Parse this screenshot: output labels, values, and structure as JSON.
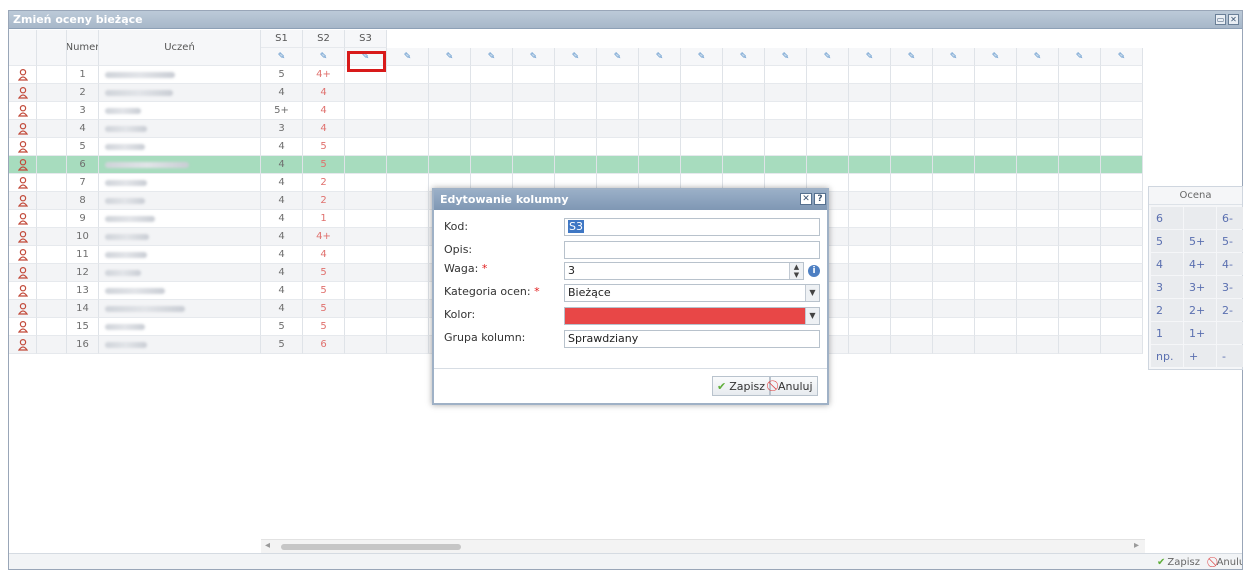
{
  "window": {
    "title": "Zmień oceny bieżące"
  },
  "grid": {
    "headers": {
      "numer": "Numer",
      "uczen": "Uczeń",
      "s1": "S1",
      "s2": "S2",
      "s3": "S3"
    },
    "rows": [
      {
        "num": "1",
        "s1": "5",
        "s2": "4+"
      },
      {
        "num": "2",
        "s1": "4",
        "s2": "4"
      },
      {
        "num": "3",
        "s1": "5+",
        "s2": "4"
      },
      {
        "num": "4",
        "s1": "3",
        "s2": "4"
      },
      {
        "num": "5",
        "s1": "4",
        "s2": "5"
      },
      {
        "num": "6",
        "s1": "4",
        "s2": "5"
      },
      {
        "num": "7",
        "s1": "4",
        "s2": "2"
      },
      {
        "num": "8",
        "s1": "4",
        "s2": "2"
      },
      {
        "num": "9",
        "s1": "4",
        "s2": "1"
      },
      {
        "num": "10",
        "s1": "4",
        "s2": "4+"
      },
      {
        "num": "11",
        "s1": "4",
        "s2": "4"
      },
      {
        "num": "12",
        "s1": "4",
        "s2": "5"
      },
      {
        "num": "13",
        "s1": "4",
        "s2": "5"
      },
      {
        "num": "14",
        "s1": "4",
        "s2": "5"
      },
      {
        "num": "15",
        "s1": "5",
        "s2": "5"
      },
      {
        "num": "16",
        "s1": "5",
        "s2": "6"
      }
    ]
  },
  "ocena_panel": {
    "header": "Ocena",
    "grades": [
      "6",
      "",
      "6-",
      "5",
      "5+",
      "5-",
      "4",
      "4+",
      "4-",
      "3",
      "3+",
      "3-",
      "2",
      "2+",
      "2-",
      "1",
      "1+",
      "",
      "np.",
      "+",
      "-"
    ]
  },
  "dialog": {
    "title": "Edytowanie kolumny",
    "kod_label": "Kod:",
    "kod_value": "S3",
    "opis_label": "Opis:",
    "opis_value": "",
    "waga_label": "Waga:",
    "waga_value": "3",
    "kategoria_label": "Kategoria ocen:",
    "kategoria_value": "Bieżące",
    "kolor_label": "Kolor:",
    "kolor_value": "#e84747",
    "grupa_label": "Grupa kolumn:",
    "grupa_value": "Sprawdziany",
    "required_mark": "*",
    "save_label": "Zapisz",
    "cancel_label": "Anuluj"
  },
  "bottombar": {
    "save_label": "Zapisz",
    "cancel_label": "Anuluj"
  },
  "colors": {
    "accent": "#4b89c6",
    "selected_row": "#a7dcbe",
    "highlight": "#d81a1a"
  }
}
